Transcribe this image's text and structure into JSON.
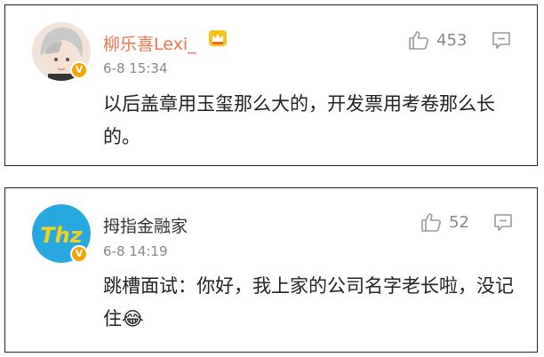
{
  "comments": [
    {
      "username": "柳乐喜Lexi_",
      "time": "6-8 15:34",
      "likes": "453",
      "content": "以后盖章用玉玺那么大的，开发票用考卷那么长的。",
      "badge_icon": "crown-icon",
      "username_color": "#eb7350"
    },
    {
      "username": "拇指金融家",
      "time": "6-8 14:19",
      "likes": "52",
      "content": "跳槽面试：你好，我上家的公司名字老长啦，没记住",
      "emoji": "😂",
      "username_color": "#333333"
    }
  ],
  "colors": {
    "verified": "#f7a400",
    "muted": "#888888"
  }
}
